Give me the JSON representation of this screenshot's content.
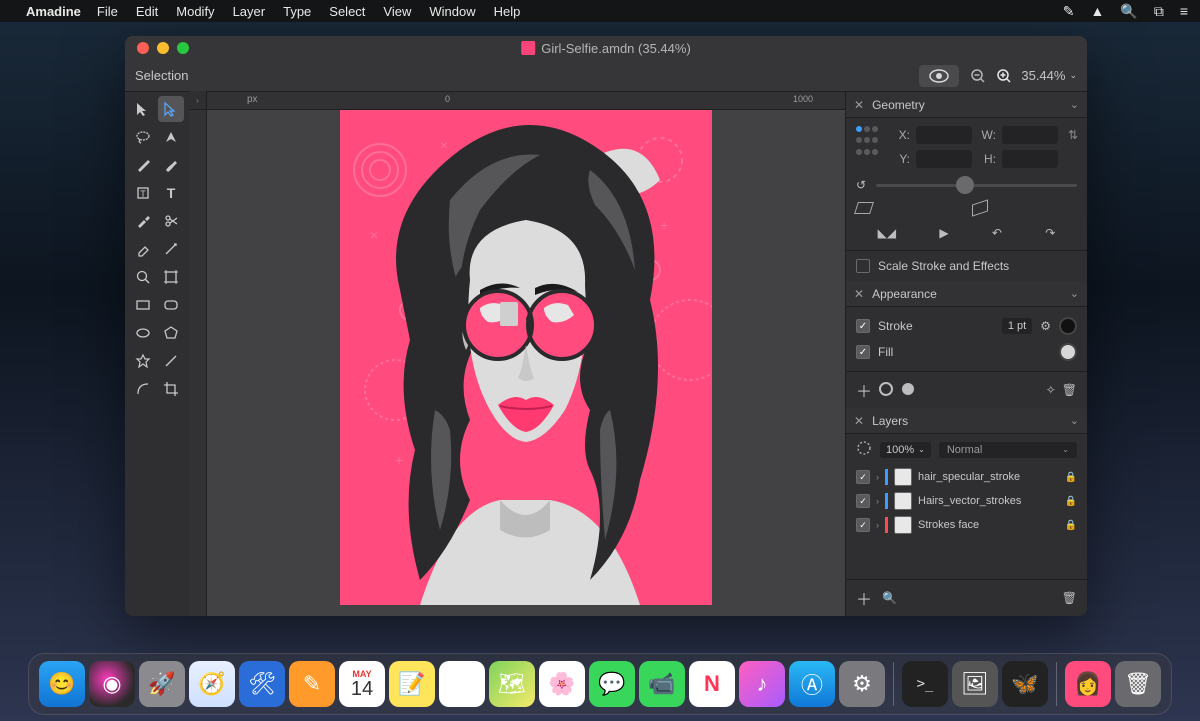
{
  "menubar": {
    "app": "Amadine",
    "items": [
      "File",
      "Edit",
      "Modify",
      "Layer",
      "Type",
      "Select",
      "View",
      "Window",
      "Help"
    ]
  },
  "window": {
    "title": "Girl-Selfie.amdn (35.44%)"
  },
  "optionsbar": {
    "mode": "Selection",
    "zoom": "35.44%"
  },
  "ruler": {
    "unit": "px",
    "t0": "0",
    "t1": "1000"
  },
  "geometry": {
    "title": "Geometry",
    "x_label": "X:",
    "y_label": "Y:",
    "w_label": "W:",
    "h_label": "H:",
    "scale_label": "Scale Stroke and Effects"
  },
  "appearance": {
    "title": "Appearance",
    "stroke_label": "Stroke",
    "stroke_value": "1 pt",
    "fill_label": "Fill"
  },
  "layers": {
    "title": "Layers",
    "opacity": "100%",
    "blend": "Normal",
    "items": [
      {
        "name": "hair_specular_stroke",
        "color": "b"
      },
      {
        "name": "Hairs_vector_strokes",
        "color": "b"
      },
      {
        "name": "Strokes face",
        "color": "r"
      }
    ]
  },
  "calendar": {
    "month": "MAY",
    "day": "14"
  }
}
